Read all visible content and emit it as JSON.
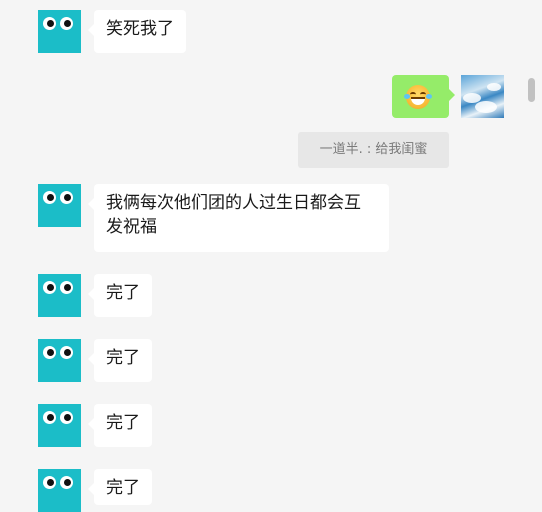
{
  "messages": [
    {
      "sender": "friend",
      "avatar_icon": "eyes-avatar-icon",
      "text": "笑死我了"
    },
    {
      "sender": "me",
      "avatar_icon": "sky-avatar-icon",
      "emoji": "face-with-tears-of-joy-icon"
    },
    {
      "quote": "一道半. : 给我闺蜜"
    },
    {
      "sender": "friend",
      "avatar_icon": "eyes-avatar-icon",
      "text_line1": "我俩每次他们团的人过生日都会互",
      "text_line2": "发祝福"
    },
    {
      "sender": "friend",
      "avatar_icon": "eyes-avatar-icon",
      "text": "完了"
    },
    {
      "sender": "friend",
      "avatar_icon": "eyes-avatar-icon",
      "text": "完了"
    },
    {
      "sender": "friend",
      "avatar_icon": "eyes-avatar-icon",
      "text": "完了"
    },
    {
      "sender": "friend",
      "avatar_icon": "eyes-avatar-icon",
      "text": "完了"
    }
  ],
  "colors": {
    "background": "#f5f5f5",
    "friend_avatar": "#1bbdc8",
    "friend_bubble": "#ffffff",
    "my_bubble": "#95ec69",
    "quote_bg": "#e7e7e7"
  }
}
